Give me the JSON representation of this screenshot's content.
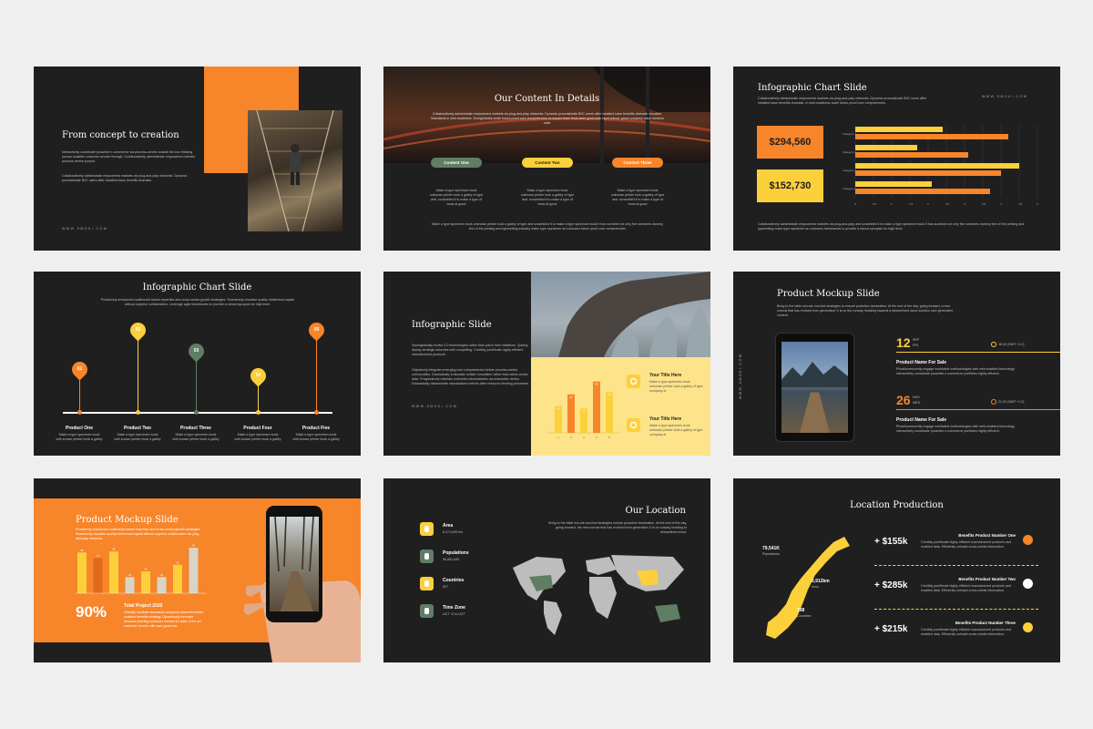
{
  "colors": {
    "orange": "#f7852a",
    "yellow": "#fcd03b",
    "green": "#5f7e64",
    "dark": "#1f1f1f",
    "pale": "#fde38a"
  },
  "url": "WWW.SMOKI.COM",
  "s1": {
    "title": "From concept to creation",
    "p1": "Interactively coordinate proactive e-commerce via process-centric outside the box thinking pursue scalable customer service through. Collaboratively administrate empowered markets process centric pursue.",
    "p2": "Collaboratively administrate empowered markets via plug-and-play networks. Dynamic procrastinate B2C users after installed base benefits dramatic."
  },
  "s2": {
    "title": "Our Content In Details",
    "intro": "Collaboratively administrate empowered markets via plug-and-play networks. Dynamic procrastinate B2C users after installed base benefits dramatic visualize. Standards in web-readiness. Energistically scale future-proof core competencies vs impact team tests seen good with input critical. great company value medium solid.",
    "pills": [
      "Content One",
      "Content Two",
      "Content Three"
    ],
    "col_text": "Make a type specimen book unknown printer took a galley of type and. scrambled it to make a type of book at good",
    "footer": "Make a type specimen book unknown printer took a galley of type and scrambled it to make a type specimen book it has survived not only five centuries dummy text of the printing and typesetting industry make type specimen an unknown future proof core competencies"
  },
  "s3": {
    "title": "Infographic Chart Slide",
    "desc": "Collaboratively administrate empowered markets via plug-and-play networks. Dynamic procrastinate B2C users after installed base benefits dramatic. In web-readiness scale future-proof core competencies.",
    "values": [
      "$294,560",
      "$152,730"
    ],
    "cats": [
      "Category 4",
      "Category 3",
      "Category 2",
      "Category 1"
    ],
    "ticks": [
      "0",
      "0.5",
      "1",
      "1.5",
      "2",
      "2.5",
      "3",
      "3.5",
      "4",
      "4.5",
      "5"
    ],
    "footer": "Collaboratively administrate empowered markets via plug-and-play and scrambled it to make a type specimen book it has survived not only five centuries dummy text of the printing and typesetting make type specimen an unknown frameworks to provide a robust synopsis for high level."
  },
  "s4": {
    "title": "Infographic Chart Slide",
    "desc": "Proactively envisioned multimedia based expertise and cross-media growth strategies. Seamlessly visualize quality intellectual capital without superior collaboration. Leverage agile frameworks to provide a robust synopsis for high level.",
    "nums": [
      "01",
      "02",
      "03",
      "04",
      "05"
    ],
    "products": [
      "Product One",
      "Product Two",
      "Product Three",
      "Product Four",
      "Product Five"
    ],
    "ptext": "Make a type specimen book with known printer book a galley"
  },
  "s5": {
    "title": "Infographic Slide",
    "p1": "Synergistically evolve 2.0 technologies rather than just in time initiatives. Quickly deploy strategic networks with compelling. Credibly pontificate highly efficient manufactured products.",
    "p2": "Objectively integrate emerging core competencies before process-centric communities. Dramatically evisculate holistic innovation rather than client-centric data. Progressively maintain extensive infomediaries via extensible niches. Dramatically disseminate standardized metrics after resource-leveling processes.",
    "item_title": "Your Title Here",
    "item_text": "Make a type specimen book unknown printer took a galley of type company is",
    "bars": [
      46,
      66,
      42,
      88,
      70
    ],
    "xt": [
      "1",
      "2",
      "3",
      "4",
      "5"
    ]
  },
  "s6": {
    "title": "Product Mockup Slide",
    "desc": "Bring to the table win-win survival strategies to ensure proactive domination. At the end of the day, going forward, a new normal that has evolved from generation X is on the runway heading towards a streamlined cloud solution user generated content.",
    "events": [
      {
        "day": "12",
        "mon": "SEP",
        "wd": "FRI",
        "time": "18.00 (GMT +1.2)",
        "name": "Product Name For Sale",
        "text": "Phosfluorescently engage worldwide methodologies with web-enabled technology interactively coordinate proactive e-commerce portfolios highly efficient."
      },
      {
        "day": "26",
        "mon": "NOV",
        "wd": "WED",
        "time": "21.00 (GMT +1.2)",
        "name": "Product Name For Sale",
        "text": "Phosfluorescently engage worldwide methodologies with web-enabled technology interactively coordinate proactive e-commerce portfolios highly efficient."
      }
    ]
  },
  "s7": {
    "title": "Product Mockup Slide",
    "desc": "Proactively envisioned multimedia based expertise and cross-media growth strategies. Seamlessly visualize quality intellectual capital without superior collaboration via plug-and-play networks.",
    "pct": "90%",
    "total": "Total Project 2020",
    "ttext": "Globally incubate standards compliant channels before scalable benefits strategy. Dynamically innovate resource-leveling customer service for state of the art customer service with user good use.",
    "bars": [
      {
        "v": 86,
        "c": "yellow"
      },
      {
        "v": 74,
        "c": "orange"
      },
      {
        "v": 88,
        "c": "yellow"
      },
      {
        "v": 34,
        "c": "gray"
      },
      {
        "v": 46,
        "c": "yellow"
      },
      {
        "v": 34,
        "c": "gray"
      },
      {
        "v": 60,
        "c": "yellow"
      },
      {
        "v": 96,
        "c": "gray"
      }
    ]
  },
  "s8": {
    "title": "Our Location",
    "desc": "Bring to the table win-win survival strategies ensure proactive domination. At the end of the day, going forward, the new normal that has evolved from generation X is on runway heading to streamlined cloud.",
    "stats": [
      {
        "label": "Area",
        "value": "6,271,649 km",
        "icon": "map-pin-icon",
        "color": "yellow"
      },
      {
        "label": "Populations",
        "value": "56,681,649",
        "icon": "person-icon",
        "color": "green"
      },
      {
        "label": "Countries",
        "value": "927",
        "icon": "flag-icon",
        "color": "yellow"
      },
      {
        "label": "Time Zone",
        "value": "UCT +2 to UCT",
        "icon": "compass-icon",
        "color": "green"
      }
    ]
  },
  "s9": {
    "title": "Location Production",
    "map_labels": [
      {
        "v": "79,541K",
        "s": "Populations"
      },
      {
        "v": "6,912km",
        "s": "Area"
      },
      {
        "v": "798",
        "s": "Countries"
      }
    ],
    "rows": [
      {
        "price": "+ $155k",
        "name": "Benefits Product Number One",
        "text": "Credibly pontificate highly efficient manufactured products and enabled data. Efficiently unleash cross-media information.",
        "icon": "basket-icon"
      },
      {
        "price": "+ $285k",
        "name": "Benefits Product Number Two",
        "text": "Credibly pontificate highly efficient manufactured products and enabled data. Efficiently unleash cross-media information.",
        "icon": "utensils-icon"
      },
      {
        "price": "+ $215k",
        "name": "Benefits Product Number Three",
        "text": "Credibly pontificate highly efficient manufactured products and enabled data. Efficiently unleash cross-media information.",
        "icon": "lightbulb-icon"
      }
    ]
  }
}
